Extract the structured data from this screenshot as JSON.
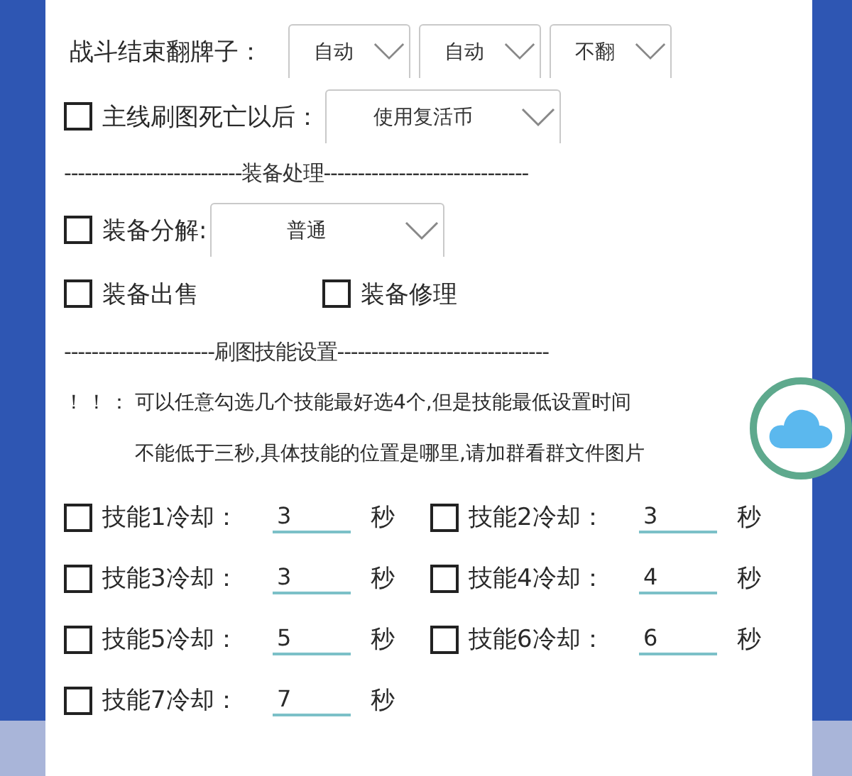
{
  "battle_flip": {
    "label": "战斗结束翻牌子：",
    "selects": [
      "自动",
      "自动",
      "不翻"
    ]
  },
  "death": {
    "checked": false,
    "label": "主线刷图死亡以后：",
    "select": "使用复活币"
  },
  "equipment_divider": "--------------------------装备处理------------------------------",
  "decompose": {
    "checked": false,
    "label": "装备分解:",
    "select": "普通"
  },
  "equipment_options": [
    {
      "checked": false,
      "label": "装备出售"
    },
    {
      "checked": false,
      "label": "装备修理"
    }
  ],
  "skill_divider": "----------------------刷图技能设置-------------------------------",
  "notice": {
    "mark": "！！：",
    "lines": [
      "可以任意勾选几个技能最好选4个,但是技能最低设置时间",
      "不能低于三秒,具体技能的位置是哪里,请加群看群文件图片"
    ]
  },
  "skills": [
    {
      "checked": false,
      "label": "技能1冷却：",
      "value": "3",
      "unit": "秒"
    },
    {
      "checked": false,
      "label": "技能2冷却：",
      "value": "3",
      "unit": "秒"
    },
    {
      "checked": false,
      "label": "技能3冷却：",
      "value": "3",
      "unit": "秒"
    },
    {
      "checked": false,
      "label": "技能4冷却：",
      "value": "4",
      "unit": "秒"
    },
    {
      "checked": false,
      "label": "技能5冷却：",
      "value": "5",
      "unit": "秒"
    },
    {
      "checked": false,
      "label": "技能6冷却：",
      "value": "6",
      "unit": "秒"
    },
    {
      "checked": false,
      "label": "技能7冷却：",
      "value": "7",
      "unit": "秒"
    }
  ]
}
